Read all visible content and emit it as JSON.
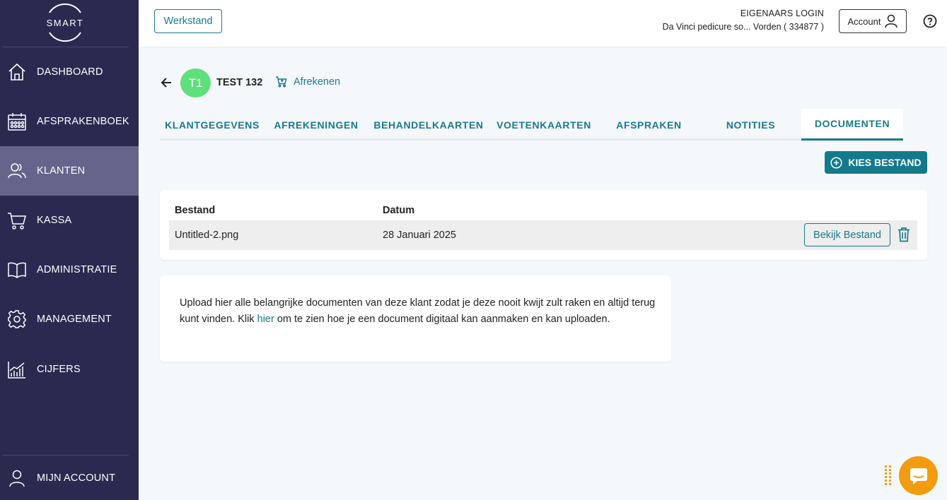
{
  "sidebar": {
    "logo_text": "SMART",
    "items": [
      {
        "label": "DASHBOARD",
        "icon": "home-icon"
      },
      {
        "label": "AFSPRAKENBOEK",
        "icon": "calendar-icon"
      },
      {
        "label": "KLANTEN",
        "icon": "users-icon",
        "active": true
      },
      {
        "label": "KASSA",
        "icon": "cart-icon"
      },
      {
        "label": "ADMINISTRATIE",
        "icon": "book-icon"
      },
      {
        "label": "MANAGEMENT",
        "icon": "gear-icon"
      },
      {
        "label": "CIJFERS",
        "icon": "chart-icon"
      }
    ],
    "account_label": "MIJN ACCOUNT"
  },
  "header": {
    "werkstand_label": "Werkstand",
    "owner_login": "EIGENAARS LOGIN",
    "salon_name": "Da Vinci pedicure so... Vorden ( 334877 )",
    "account_label": "Account"
  },
  "client": {
    "initials": "T1",
    "name": "TEST 132",
    "afrekenen_label": "Afrekenen"
  },
  "tabs": [
    {
      "label": "KLANTGEGEVENS"
    },
    {
      "label": "AFREKENINGEN"
    },
    {
      "label": "BEHANDELKAARTEN"
    },
    {
      "label": "VOETENKAARTEN"
    },
    {
      "label": "AFSPRAKEN"
    },
    {
      "label": "NOTITIES"
    },
    {
      "label": "DOCUMENTEN",
      "active": true
    }
  ],
  "documents": {
    "add_button_label": "KIES BESTAND",
    "columns": [
      "Bestand",
      "Datum"
    ],
    "rows": [
      {
        "file": "Untitled-2.png",
        "date": "28 Januari 2025",
        "view_label": "Bekijk Bestand"
      }
    ]
  },
  "info": {
    "text_before": "Upload hier alle belangrijke documenten van deze klant zodat je deze nooit kwijt zult raken en altijd terug kunt vinden. Klik ",
    "link_text": "hier",
    "text_after": " om te zien hoe je een document digitaal kan aanmaken en kan uploaden."
  },
  "colors": {
    "sidebar_bg": "#2b2950",
    "sidebar_active": "#66648a",
    "accent": "#1a7a8c",
    "avatar": "#5ee07a",
    "chat": "#f39c12"
  }
}
